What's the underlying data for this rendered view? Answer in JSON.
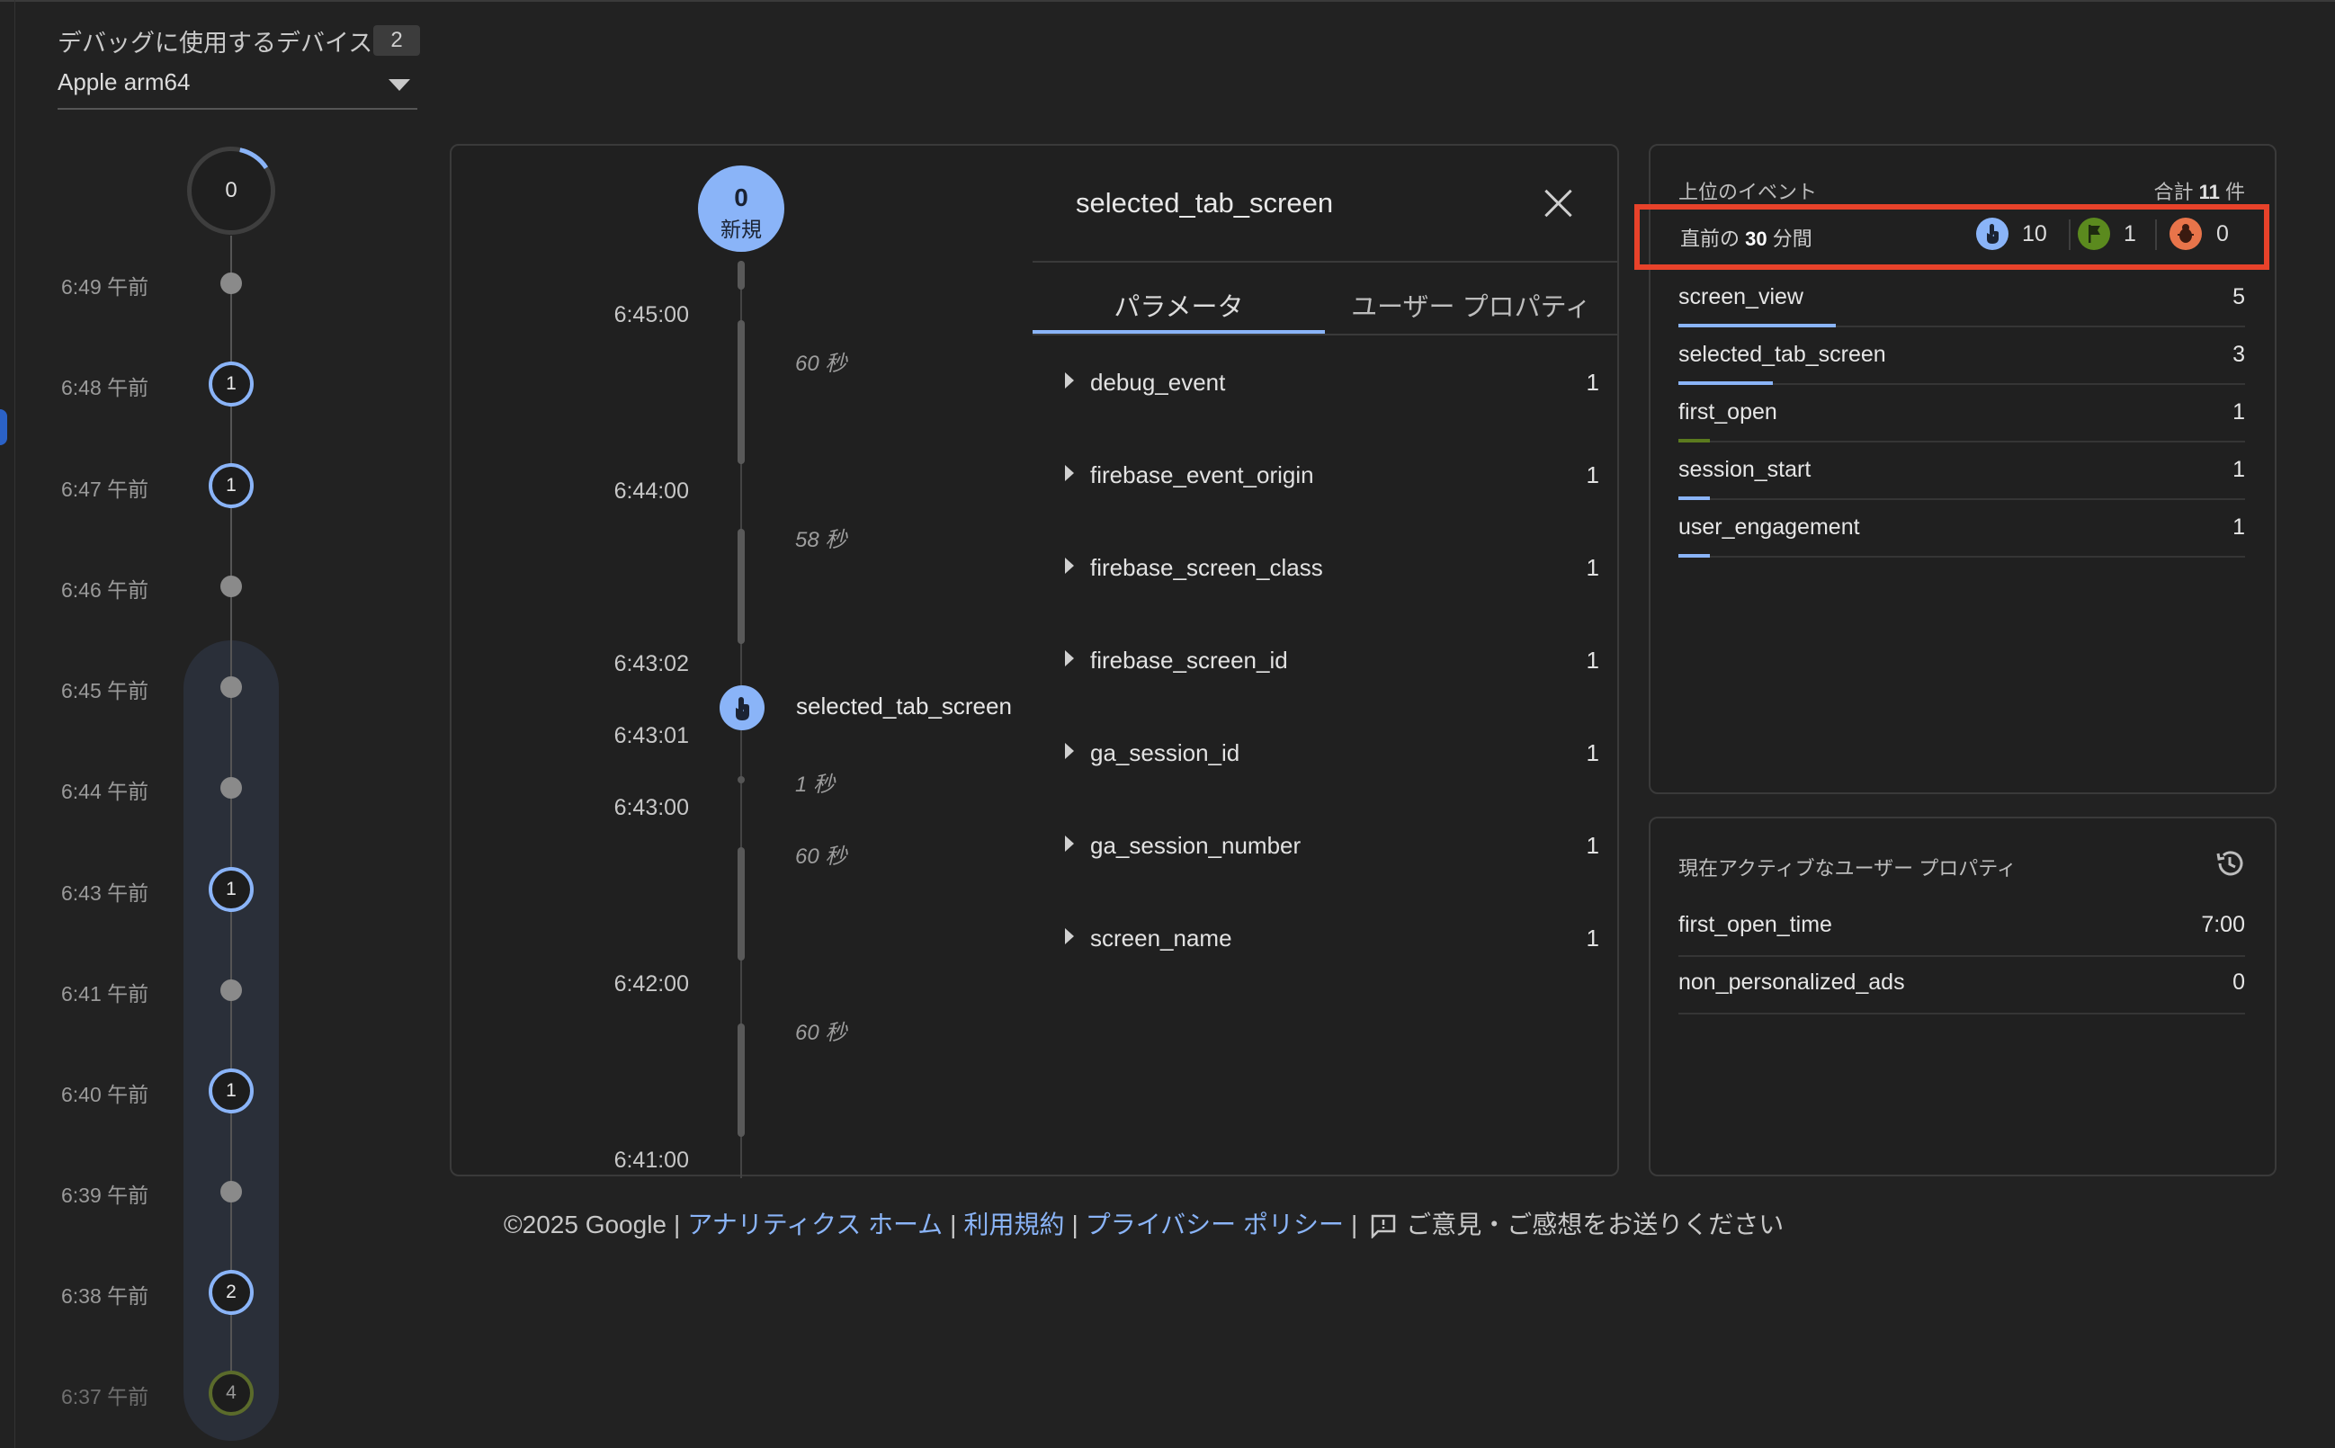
{
  "device": {
    "label": "デバッグに使用するデバイス",
    "count": "2",
    "selected": "Apple arm64"
  },
  "minute_timeline": {
    "top_count": "0",
    "rows": [
      {
        "time": "6:49 午前",
        "badge": null
      },
      {
        "time": "6:48 午前",
        "badge": "1"
      },
      {
        "time": "6:47 午前",
        "badge": "1"
      },
      {
        "time": "6:46 午前",
        "badge": null
      },
      {
        "time": "6:45 午前",
        "badge": null
      },
      {
        "time": "6:44 午前",
        "badge": null
      },
      {
        "time": "6:43 午前",
        "badge": "1"
      },
      {
        "time": "6:41 午前",
        "badge": null
      },
      {
        "time": "6:40 午前",
        "badge": "1"
      },
      {
        "time": "6:39 午前",
        "badge": null
      },
      {
        "time": "6:38 午前",
        "badge": "2"
      },
      {
        "time": "6:37 午前",
        "badge": "4"
      }
    ]
  },
  "seconds_stream": {
    "new_count": "0",
    "new_label": "新規",
    "times": [
      "6:45:00",
      "6:44:00",
      "6:43:02",
      "6:43:01",
      "6:43:00",
      "6:42:00",
      "6:41:00"
    ],
    "gaps": [
      "60 秒",
      "58 秒",
      "1 秒",
      "60 秒",
      "60 秒"
    ],
    "event_name": "selected_tab_screen"
  },
  "detail": {
    "title": "selected_tab_screen",
    "tabs": [
      "パラメータ",
      "ユーザー プロパティ"
    ],
    "params": [
      {
        "name": "debug_event",
        "value": "1"
      },
      {
        "name": "firebase_event_origin",
        "value": "1"
      },
      {
        "name": "firebase_screen_class",
        "value": "1"
      },
      {
        "name": "firebase_screen_id",
        "value": "1"
      },
      {
        "name": "ga_session_id",
        "value": "1"
      },
      {
        "name": "ga_session_number",
        "value": "1"
      },
      {
        "name": "screen_name",
        "value": "1"
      }
    ]
  },
  "top_events": {
    "title": "上位のイベント",
    "total_prefix": "合計",
    "total_value": "11",
    "total_suffix": "件",
    "summary_prefix": "直前の",
    "summary_minutes": "30",
    "summary_suffix": "分間",
    "counts": {
      "events": "10",
      "conversions": "1",
      "errors": "0"
    },
    "colors": {
      "events": "#8ab4f8",
      "conversions": "#5b8a1e",
      "errors": "#e8744a",
      "highlight": "#e8422a"
    },
    "rows": [
      {
        "name": "screen_view",
        "value": "5",
        "fraction": 0.277,
        "color": "#8ab4f8"
      },
      {
        "name": "selected_tab_screen",
        "value": "3",
        "fraction": 0.166,
        "color": "#8ab4f8"
      },
      {
        "name": "first_open",
        "value": "1",
        "fraction": 0.055,
        "color": "#5b7a1e"
      },
      {
        "name": "session_start",
        "value": "1",
        "fraction": 0.055,
        "color": "#8ab4f8"
      },
      {
        "name": "user_engagement",
        "value": "1",
        "fraction": 0.055,
        "color": "#8ab4f8"
      }
    ]
  },
  "user_properties": {
    "title": "現在アクティブなユーザー プロパティ",
    "rows": [
      {
        "name": "first_open_time",
        "value": "7:00"
      },
      {
        "name": "non_personalized_ads",
        "value": "0"
      }
    ]
  },
  "footer": {
    "copyright": "©2025 Google",
    "links": [
      "アナリティクス ホーム",
      "利用規約",
      "プライバシー ポリシー"
    ],
    "feedback": "ご意見・ご感想をお送りください"
  }
}
